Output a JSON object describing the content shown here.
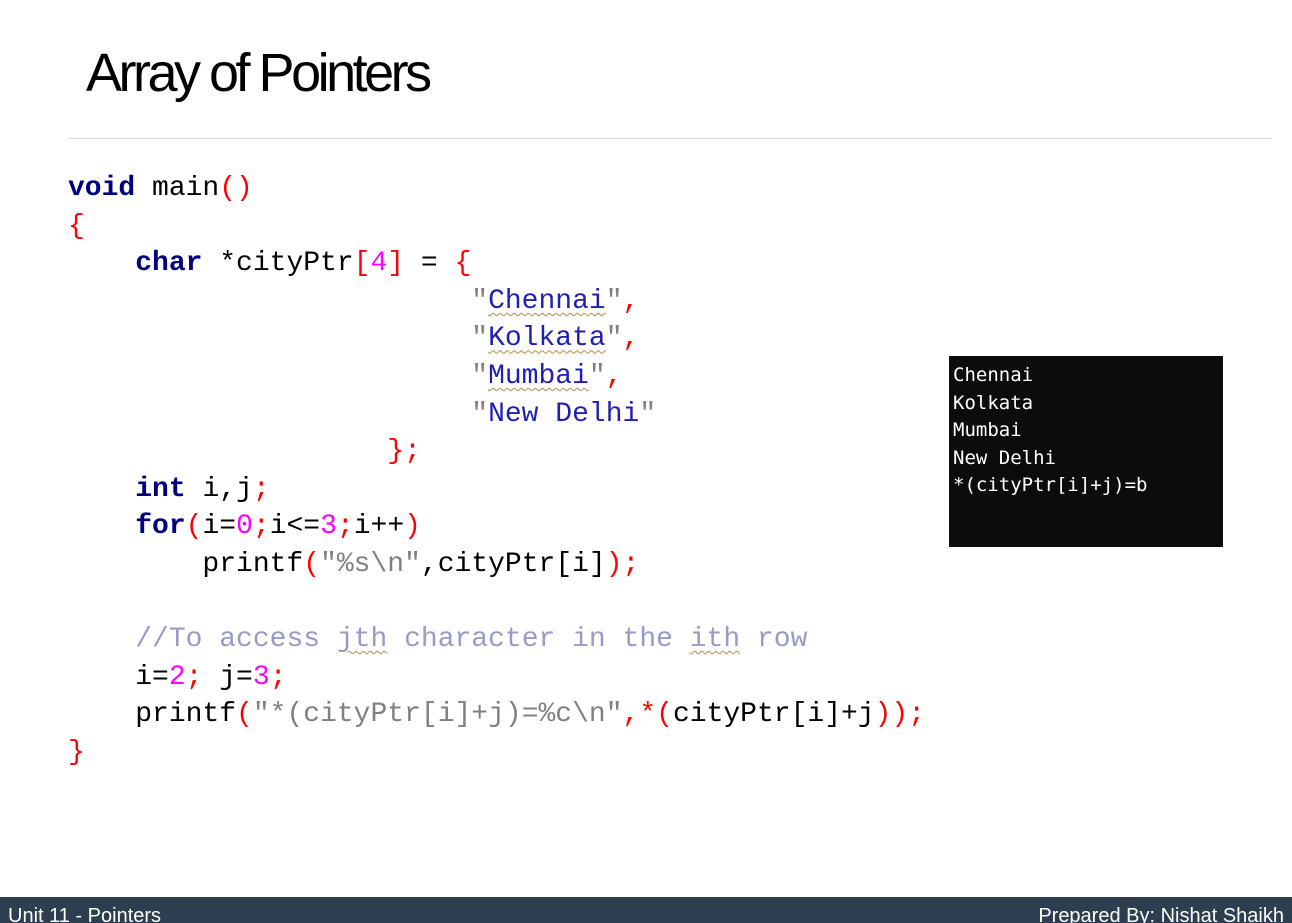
{
  "slide": {
    "title": "Array of Pointers"
  },
  "code": {
    "void": "void",
    "main_name": " main",
    "char": "char",
    "city_decl": " *cityPtr",
    "eq": " = ",
    "open_paren": "(",
    "close_paren": ")",
    "open_brace": "{",
    "close_brace": "}",
    "open_bracket": "[",
    "close_bracket": "]",
    "semicolon": ";",
    "four": "4",
    "cities": [
      "Chennai",
      "Kolkata",
      "Mumbai",
      "New Delhi"
    ],
    "quote": "\"",
    "comma": ",",
    "int": "int",
    "ij_decl": " i,j",
    "for": "for",
    "for_i_eq": "i=",
    "zero": "0",
    "for_cond": "i<=",
    "three": "3",
    "for_incr": "i++",
    "printf": "printf",
    "printf1_str": "\"%s\\n\"",
    "printf1_arg": ",cityPtr[i]",
    "comment_prefix": "//To access ",
    "comment_jth": "jth",
    "comment_mid": " character in the ",
    "comment_ith": "ith",
    "comment_suffix": " row",
    "assign_i": "i=",
    "two": "2",
    "assign_j": " j=",
    "printf2_str": "\"*(cityPtr[i]+j)=%c\\n\"",
    "printf2_sep": ",",
    "star": "*",
    "printf2_arg": "cityPtr[i]+j"
  },
  "console": {
    "lines": [
      "Chennai",
      "Kolkata",
      "Mumbai",
      "New Delhi",
      "*(cityPtr[i]+j)=b"
    ]
  },
  "footer": {
    "left": "Unit 11 - Pointers",
    "right": "Prepared By: Nishat Shaikh"
  },
  "colors": {
    "keyword": "#000080",
    "bracket": "#ff0000",
    "number": "#ff00ff",
    "string": "#1f1fb5",
    "comment": "#9a9ac8",
    "console_bg": "#0c0c0c",
    "footer_bg": "#2d3e50"
  }
}
